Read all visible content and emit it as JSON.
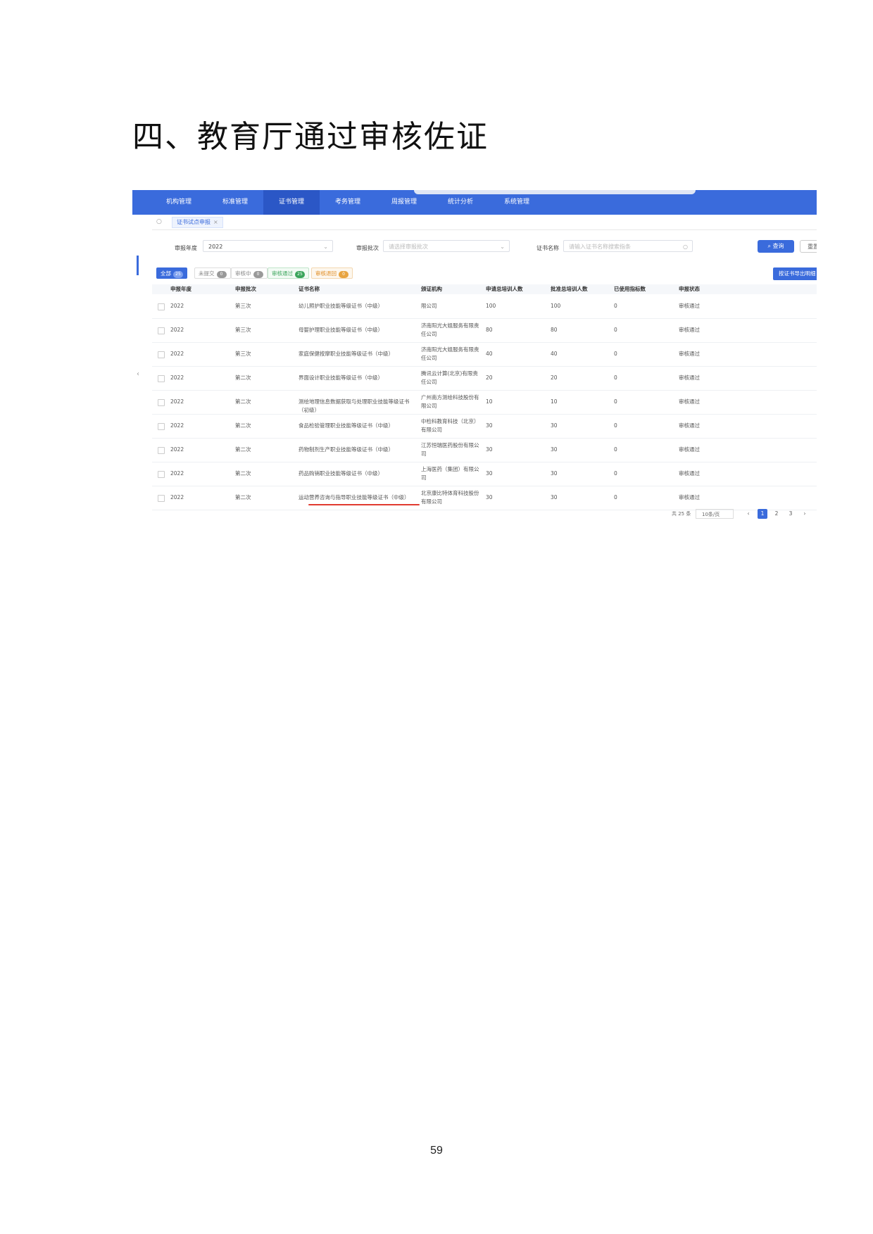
{
  "heading": "四、教育厅通过审核佐证",
  "page_number": "59",
  "nav": {
    "items": [
      "机构管理",
      "标准管理",
      "证书管理",
      "考务管理",
      "周报管理",
      "统计分析",
      "系统管理"
    ],
    "active": "证书管理"
  },
  "tab": {
    "current": "证书试点申报",
    "close": "×"
  },
  "filters": {
    "year_label": "审报年度",
    "year_value": "2022",
    "batch_label": "审报批次",
    "batch_placeholder": "请选择审报批次",
    "cert_label": "证书名称",
    "cert_placeholder": "请输入证书名称搜索指条",
    "search_button": "查询",
    "reset_button": "重置"
  },
  "status_tabs": [
    {
      "label": "全部",
      "count": "25"
    },
    {
      "label": "未提交",
      "count": "0"
    },
    {
      "label": "审核中",
      "count": "0"
    },
    {
      "label": "审核通过",
      "count": "25"
    },
    {
      "label": "审核退回",
      "count": "0"
    }
  ],
  "export_button": "按证书导出明细",
  "table": {
    "headers": [
      "申报年度",
      "申报批次",
      "证书名称",
      "颁证机构",
      "申请总培训人数",
      "批准总培训人数",
      "已使用指标数",
      "申报状态"
    ],
    "rows": [
      {
        "year": "2022",
        "batch": "第三次",
        "name": "幼儿照护职业技能等级证书（中级）",
        "org": "限公司",
        "apply": "100",
        "approve": "100",
        "used": "0",
        "status": "审核通过"
      },
      {
        "year": "2022",
        "batch": "第三次",
        "name": "母婴护理职业技能等级证书（中级）",
        "org": "济南阳光大姐服务有限责任公司",
        "apply": "80",
        "approve": "80",
        "used": "0",
        "status": "审核通过"
      },
      {
        "year": "2022",
        "batch": "第三次",
        "name": "家庭保健按摩职业技能等级证书（中级）",
        "org": "济南阳光大姐服务有限责任公司",
        "apply": "40",
        "approve": "40",
        "used": "0",
        "status": "审核通过"
      },
      {
        "year": "2022",
        "batch": "第二次",
        "name": "界面设计职业技能等级证书（中级）",
        "org": "腾讯云计算(北京)有限责任公司",
        "apply": "20",
        "approve": "20",
        "used": "0",
        "status": "审核通过"
      },
      {
        "year": "2022",
        "batch": "第二次",
        "name": "测绘地理信息数据获取与处理职业技能等级证书（初级）",
        "org": "广州南方测绘科技股份有限公司",
        "apply": "10",
        "approve": "10",
        "used": "0",
        "status": "审核通过"
      },
      {
        "year": "2022",
        "batch": "第二次",
        "name": "食品检验管理职业技能等级证书（中级）",
        "org": "中检科教育科技（北京）有限公司",
        "apply": "30",
        "approve": "30",
        "used": "0",
        "status": "审核通过"
      },
      {
        "year": "2022",
        "batch": "第二次",
        "name": "药物制剂生产职业技能等级证书（中级）",
        "org": "江苏恒瑞医药股份有限公司",
        "apply": "30",
        "approve": "30",
        "used": "0",
        "status": "审核通过"
      },
      {
        "year": "2022",
        "batch": "第二次",
        "name": "药品购销职业技能等级证书（中级）",
        "org": "上海医药（集团）有限公司",
        "apply": "30",
        "approve": "30",
        "used": "0",
        "status": "审核通过"
      },
      {
        "year": "2022",
        "batch": "第二次",
        "name": "运动营养咨询与指导职业技能等级证书（中级）",
        "org": "北京康比特体育科技股份有限公司",
        "apply": "30",
        "approve": "30",
        "used": "0",
        "status": "审核通过"
      }
    ]
  },
  "pagination": {
    "total": "共 25 条",
    "page_size": "10条/页",
    "prev": "‹",
    "pages": [
      "1",
      "2",
      "3"
    ],
    "next": "›"
  }
}
